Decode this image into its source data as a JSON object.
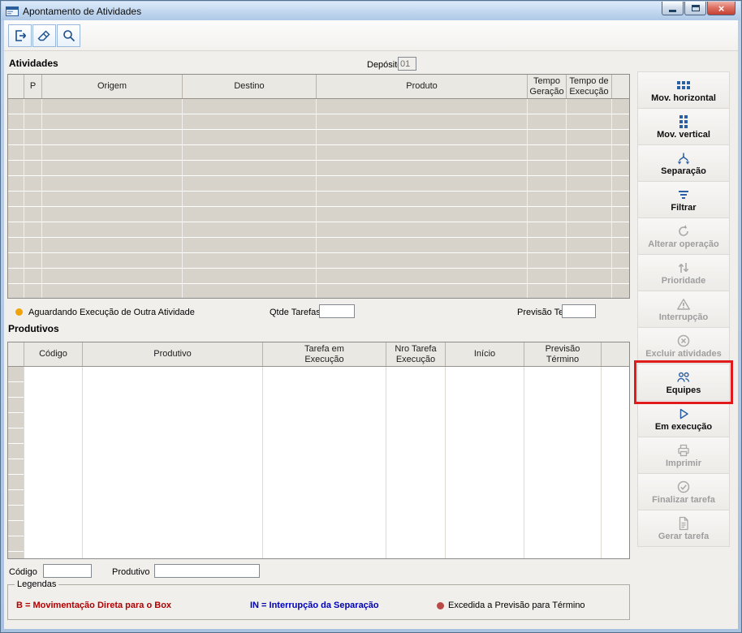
{
  "window": {
    "title": "Apontamento de Atividades",
    "controls": [
      {
        "name": "minimize"
      },
      {
        "name": "maximize"
      },
      {
        "name": "close"
      }
    ]
  },
  "toolbar": {
    "buttons": [
      {
        "name": "exit",
        "icon": "exit-icon"
      },
      {
        "name": "clear",
        "icon": "eraser-icon"
      },
      {
        "name": "search",
        "icon": "search-icon"
      }
    ]
  },
  "atividades": {
    "section_label": "Atividades",
    "deposito_label": "Depósito",
    "deposito_value": "01",
    "columns": [
      "",
      "P",
      "Origem",
      "Destino",
      "Produto",
      "Tempo\nGeração",
      "Tempo de\nExecução",
      ""
    ]
  },
  "status_row": {
    "waiting_text": "Aguardando Execução de Outra Atividade",
    "waiting_dot_color": "#f0a30a",
    "qtde_tarefas_label": "Qtde Tarefas",
    "qtde_tarefas_value": "",
    "previsao_tempo_label": "Previsão Tempo",
    "previsao_tempo_value": ""
  },
  "produtivos": {
    "section_label": "Produtivos",
    "columns": [
      "",
      "Código",
      "Produtivo",
      "Tarefa em\nExecução",
      "Nro Tarefa\nExecução",
      "Início",
      "Previsão\nTérmino",
      ""
    ]
  },
  "sidebar": {
    "highlight_color": "#e11b1b",
    "buttons": [
      {
        "label": "Mov. horizontal",
        "icon": "grid-horizontal-icon",
        "enabled": true,
        "highlighted": false
      },
      {
        "label": "Mov. vertical",
        "icon": "grid-vertical-icon",
        "enabled": true,
        "highlighted": false
      },
      {
        "label": "Separação",
        "icon": "separation-icon",
        "enabled": true,
        "highlighted": false
      },
      {
        "label": "Filtrar",
        "icon": "filter-icon",
        "enabled": true,
        "highlighted": false
      },
      {
        "label": "Alterar operação",
        "icon": "refresh-icon",
        "enabled": false,
        "highlighted": false
      },
      {
        "label": "Prioridade",
        "icon": "priority-arrows-icon",
        "enabled": false,
        "highlighted": false
      },
      {
        "label": "Interrupção",
        "icon": "warning-icon",
        "enabled": false,
        "highlighted": false
      },
      {
        "label": "Excluir atividades",
        "icon": "delete-circle-icon",
        "enabled": false,
        "highlighted": false
      },
      {
        "label": "Equipes",
        "icon": "people-icon",
        "enabled": true,
        "highlighted": true
      },
      {
        "label": "Em execução",
        "icon": "play-icon",
        "enabled": true,
        "highlighted": false
      },
      {
        "label": "Imprimir",
        "icon": "printer-icon",
        "enabled": false,
        "highlighted": false
      },
      {
        "label": "Finalizar tarefa",
        "icon": "check-circle-icon",
        "enabled": false,
        "highlighted": false
      },
      {
        "label": "Gerar tarefa",
        "icon": "document-icon",
        "enabled": false,
        "highlighted": false
      }
    ]
  },
  "footer": {
    "codigo_label": "Código",
    "codigo_value": "",
    "produtivo_label": "Produtivo",
    "produtivo_value": ""
  },
  "legendas": {
    "title": "Legendas",
    "items": [
      {
        "text": "B = Movimentação Direta para o Box",
        "color": "#b00000",
        "bold": true
      },
      {
        "text": "IN = Interrupção da Separação",
        "color": "#0000b4",
        "bold": true
      },
      {
        "text": "Excedida a Previsão para Término",
        "color": "#000000",
        "bold": false,
        "dot_color": "#b94a45"
      }
    ]
  }
}
